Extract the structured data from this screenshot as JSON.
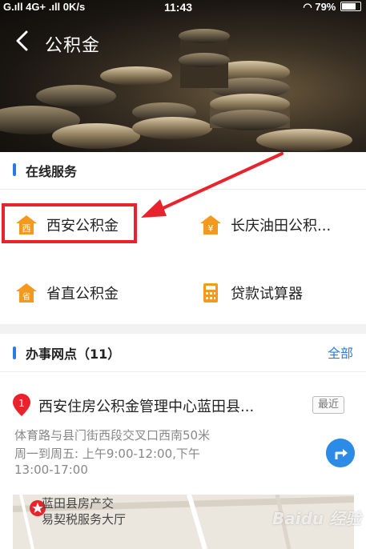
{
  "status_bar": {
    "left": "G.ıll 4G+ .ıll 0K/s",
    "time": "11:43",
    "battery": "79%"
  },
  "nav": {
    "title": "公积金"
  },
  "online_services": {
    "title": "在线服务",
    "items": [
      {
        "label": "西安公积金",
        "icon": "xi-house-icon",
        "icon_char": "西"
      },
      {
        "label": "长庆油田公积...",
        "icon": "yuan-house-icon",
        "icon_char": "¥"
      },
      {
        "label": "省直公积金",
        "icon": "sheng-house-icon",
        "icon_char": "省"
      },
      {
        "label": "贷款试算器",
        "icon": "calculator-icon"
      }
    ]
  },
  "offices": {
    "title": "办事网点（11）",
    "all_label": "全部",
    "first": {
      "index": "1",
      "name": "西安住房公积金管理中心蓝田县...",
      "badge": "最近",
      "address": "体育路与县门街西段交叉口西南50米",
      "hours_line1": "周一到周五: 上午9:00-12:00,下午",
      "hours_line2": "13:00-17:00"
    }
  },
  "map": {
    "label_line1": "蓝田县房产交",
    "label_line2": "易契税服务大厅"
  },
  "watermark": "Baidu 经验",
  "colors": {
    "accent_blue": "#2a7ce0",
    "icon_orange": "#f39a1e",
    "highlight_red": "#e8232b",
    "pin_red": "#e8232b"
  }
}
